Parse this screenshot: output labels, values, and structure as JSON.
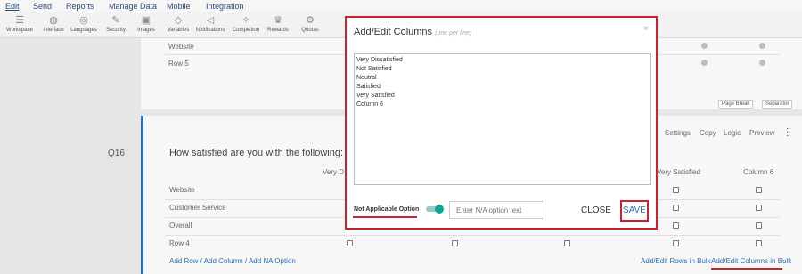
{
  "menu": [
    "Edit",
    "Send",
    "Reports",
    "Manage Data",
    "Mobile",
    "Integration"
  ],
  "toolbar": [
    "Workspace",
    "Interface",
    "Languages",
    "Security",
    "Images",
    "Variables",
    "Notifications",
    "Completion",
    "Rewards",
    "Quotas"
  ],
  "top_rows": [
    "Website",
    "Row 5"
  ],
  "top_buttons": {
    "page_break": "Page Break",
    "separator": "Separator"
  },
  "question": {
    "number": "Q16",
    "text": "How satisfied are you with the following:",
    "actions": [
      "Settings",
      "Copy",
      "Logic",
      "Preview"
    ],
    "col_headers": {
      "left": "Very D",
      "right": "Very Satisfied",
      "last": "Column 6"
    },
    "rows": [
      "Website",
      "Customer Service",
      "Overall",
      "Row 4"
    ]
  },
  "links": {
    "add": "Add Row / Add Column / Add NA Option",
    "bulk_rows": "Add/Edit Rows in Bulk",
    "bulk_cols": "Add/Edit Columns in Bulk"
  },
  "modal": {
    "title": "Add/Edit Columns",
    "subtitle": "(one per line)",
    "close": "×",
    "columns": [
      "Very Dissatisfied",
      "Not Satisfied",
      "Neutral",
      "Satisfied",
      "Very Satisfied",
      "Column 6"
    ],
    "na_label": "Not Applicable Option",
    "na_enabled": true,
    "na_placeholder": "Enter N/A option text",
    "cancel": "CLOSE",
    "save": "SAVE"
  },
  "colors": {
    "accent": "#2d6db5",
    "highlight": "#c9242b",
    "toggle": "#11a396"
  }
}
